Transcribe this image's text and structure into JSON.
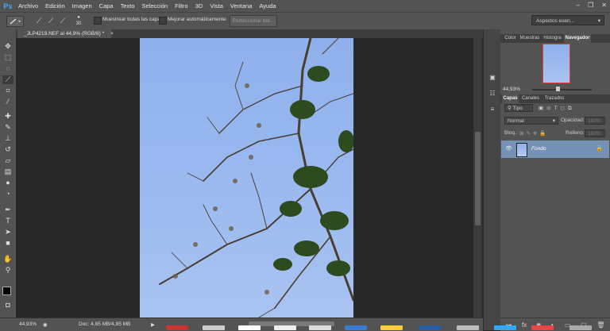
{
  "app": {
    "logo": "Ps"
  },
  "menu": [
    "Archivo",
    "Edición",
    "Imagen",
    "Capa",
    "Texto",
    "Selección",
    "Filtro",
    "3D",
    "Vista",
    "Ventana",
    "Ayuda"
  ],
  "window_controls": {
    "minimize": "–",
    "restore": "❐",
    "close": "✕"
  },
  "options_bar": {
    "tool_icon": "brush-icon",
    "brush_size": "30",
    "sample_all_layers_label": "Muestrear todas las capas",
    "auto_enhance_label": "Mejorar automáticamente",
    "refine_edge_label": "Perfeccionar bor...",
    "workspace_label": "Aspectos esen..."
  },
  "document": {
    "tab_title": "_JLP4219.NEF al 44,9% (RGB/8) *",
    "close": "×"
  },
  "status": {
    "zoom": "44,93%",
    "doc_info": "Doc: 4,85 MB/4,85 MB"
  },
  "panels": {
    "top_tabs": [
      "Color",
      "Muestras",
      "Histogra",
      "Navegador"
    ],
    "navigator_zoom": "44,93%",
    "layer_tabs": [
      "Capas",
      "Canales",
      "Trazados"
    ],
    "kind_filter": "Tipo",
    "blend_mode": "Normal",
    "opacity_label": "Opacidad:",
    "opacity_value": "100%",
    "lock_label": "Bloq.:",
    "fill_label": "Relleno:",
    "fill_value": "100%",
    "layer_name": "Fondo"
  },
  "colors": {
    "accent_tab": "#535353",
    "layer_selected": "#7491b6",
    "sky": "#98b8ef"
  }
}
